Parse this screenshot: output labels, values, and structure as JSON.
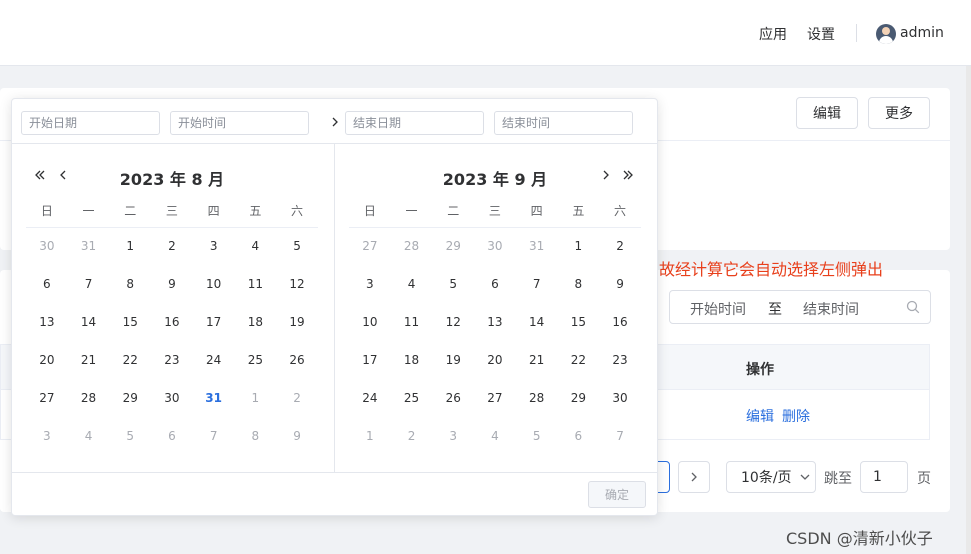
{
  "header": {
    "nav_apps": "应用",
    "nav_settings": "设置",
    "username": "admin"
  },
  "toolbar": {
    "edit_label": "编辑",
    "more_label": "更多"
  },
  "annotation_text": "故经计算它会自动选择左侧弹出",
  "search_range": {
    "start_placeholder": "开始时间",
    "separator": "至",
    "end_placeholder": "结束时间"
  },
  "table": {
    "action_header": "操作",
    "row_edit": "编辑",
    "row_delete": "删除"
  },
  "pagination": {
    "page_size": "10条/页",
    "jump_label": "跳至",
    "jump_value": "1",
    "page_suffix": "页"
  },
  "watermark": "CSDN @清新小伙子",
  "picker": {
    "start_date_placeholder": "开始日期",
    "start_time_placeholder": "开始时间",
    "end_date_placeholder": "结束日期",
    "end_time_placeholder": "结束时间",
    "confirm_label": "确定",
    "weekdays": [
      "日",
      "一",
      "二",
      "三",
      "四",
      "五",
      "六"
    ],
    "left": {
      "title": "2023 年 8 月",
      "weeks": [
        [
          {
            "d": "30",
            "o": 1
          },
          {
            "d": "31",
            "o": 1
          },
          {
            "d": "1"
          },
          {
            "d": "2"
          },
          {
            "d": "3"
          },
          {
            "d": "4"
          },
          {
            "d": "5"
          }
        ],
        [
          {
            "d": "6"
          },
          {
            "d": "7"
          },
          {
            "d": "8"
          },
          {
            "d": "9"
          },
          {
            "d": "10"
          },
          {
            "d": "11"
          },
          {
            "d": "12"
          }
        ],
        [
          {
            "d": "13"
          },
          {
            "d": "14"
          },
          {
            "d": "15"
          },
          {
            "d": "16"
          },
          {
            "d": "17"
          },
          {
            "d": "18"
          },
          {
            "d": "19"
          }
        ],
        [
          {
            "d": "20"
          },
          {
            "d": "21"
          },
          {
            "d": "22"
          },
          {
            "d": "23"
          },
          {
            "d": "24"
          },
          {
            "d": "25"
          },
          {
            "d": "26"
          }
        ],
        [
          {
            "d": "27"
          },
          {
            "d": "28"
          },
          {
            "d": "29"
          },
          {
            "d": "30"
          },
          {
            "d": "31",
            "t": 1
          },
          {
            "d": "1",
            "o": 1
          },
          {
            "d": "2",
            "o": 1
          }
        ],
        [
          {
            "d": "3",
            "o": 1
          },
          {
            "d": "4",
            "o": 1
          },
          {
            "d": "5",
            "o": 1
          },
          {
            "d": "6",
            "o": 1
          },
          {
            "d": "7",
            "o": 1
          },
          {
            "d": "8",
            "o": 1
          },
          {
            "d": "9",
            "o": 1
          }
        ]
      ]
    },
    "right": {
      "title": "2023 年 9 月",
      "weeks": [
        [
          {
            "d": "27",
            "o": 1
          },
          {
            "d": "28",
            "o": 1
          },
          {
            "d": "29",
            "o": 1
          },
          {
            "d": "30",
            "o": 1
          },
          {
            "d": "31",
            "o": 1
          },
          {
            "d": "1"
          },
          {
            "d": "2"
          }
        ],
        [
          {
            "d": "3"
          },
          {
            "d": "4"
          },
          {
            "d": "5"
          },
          {
            "d": "6"
          },
          {
            "d": "7"
          },
          {
            "d": "8"
          },
          {
            "d": "9"
          }
        ],
        [
          {
            "d": "10"
          },
          {
            "d": "11"
          },
          {
            "d": "12"
          },
          {
            "d": "13"
          },
          {
            "d": "14"
          },
          {
            "d": "15"
          },
          {
            "d": "16"
          }
        ],
        [
          {
            "d": "17"
          },
          {
            "d": "18"
          },
          {
            "d": "19"
          },
          {
            "d": "20"
          },
          {
            "d": "21"
          },
          {
            "d": "22"
          },
          {
            "d": "23"
          }
        ],
        [
          {
            "d": "24"
          },
          {
            "d": "25"
          },
          {
            "d": "26"
          },
          {
            "d": "27"
          },
          {
            "d": "28"
          },
          {
            "d": "29"
          },
          {
            "d": "30"
          }
        ],
        [
          {
            "d": "1",
            "o": 1
          },
          {
            "d": "2",
            "o": 1
          },
          {
            "d": "3",
            "o": 1
          },
          {
            "d": "4",
            "o": 1
          },
          {
            "d": "5",
            "o": 1
          },
          {
            "d": "6",
            "o": 1
          },
          {
            "d": "7",
            "o": 1
          }
        ]
      ]
    }
  }
}
